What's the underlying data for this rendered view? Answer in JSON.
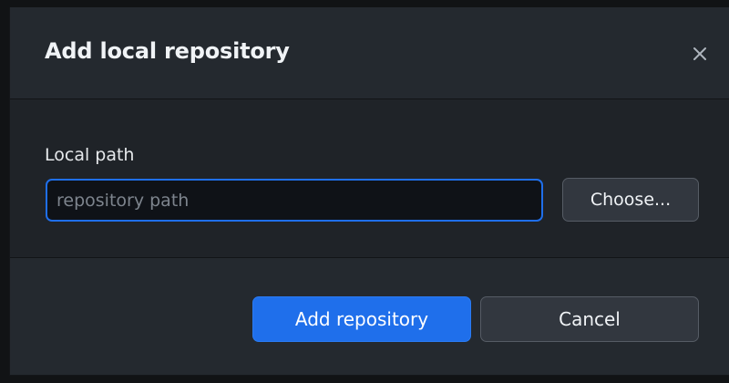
{
  "dialog": {
    "title": "Add local repository",
    "close_icon": "close-icon"
  },
  "form": {
    "local_path_label": "Local path",
    "path_input": {
      "value": "",
      "placeholder": "repository path"
    },
    "choose_label": "Choose..."
  },
  "footer": {
    "add_label": "Add repository",
    "cancel_label": "Cancel"
  },
  "colors": {
    "accent": "#1f6feb",
    "dialog_background": "#24292f",
    "content_background": "#1f2328",
    "input_background": "#0f1217",
    "secondary_button": "#32373f"
  }
}
